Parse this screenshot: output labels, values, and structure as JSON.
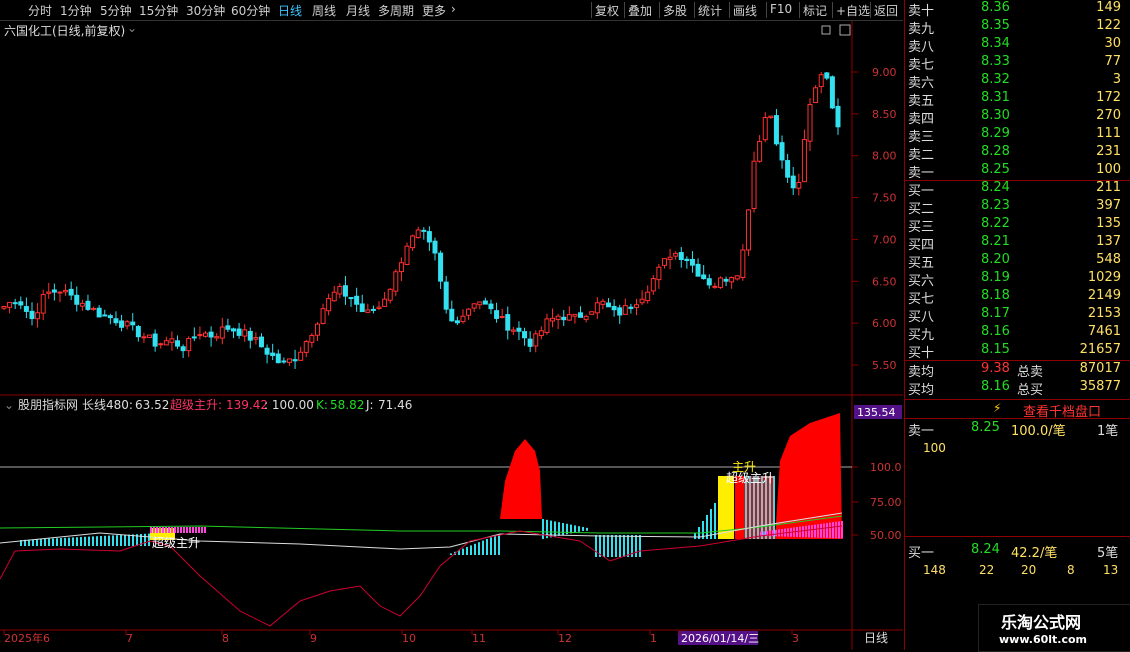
{
  "toolbar": {
    "tabs": [
      "分时",
      "1分钟",
      "5分钟",
      "15分钟",
      "30分钟",
      "60分钟",
      "日线",
      "周线",
      "月线",
      "多周期",
      "更多"
    ],
    "active_tab": "日线",
    "right_buttons": [
      "复权",
      "叠加",
      "多股",
      "统计",
      "画线",
      "F10",
      "标记",
      "+自选",
      "返回"
    ]
  },
  "chart": {
    "title": "六国化工(日线,前复权)",
    "price_axis": [
      "9.00",
      "8.50",
      "8.00",
      "7.50",
      "7.00",
      "6.50",
      "6.00",
      "5.50"
    ],
    "indicator_axis": [
      "100.0",
      "75.00",
      "50.00"
    ],
    "indicator_top_value": "135.54",
    "indicator_header": {
      "name": "股朋指标网",
      "long_label": "长线480:",
      "long_value": "63.52",
      "super_label": "超级主升:",
      "super_value": "139.42",
      "sep_value": ": 100.00",
      "k_label": "K:",
      "k_value": "58.82",
      "j_label": "J:",
      "j_value": "71.46"
    },
    "annotation_left": "超级主升",
    "annotation_right_top": "主升",
    "annotation_right": "超级主升",
    "x_axis": [
      "2025年6",
      "7",
      "8",
      "9",
      "10",
      "11",
      "12",
      "1",
      "2026/01/14/三",
      "3"
    ],
    "period_label": "日线"
  },
  "colors": {
    "up": "#ff3030",
    "down": "#33e0f0",
    "green": "#22dd22",
    "yellow": "#ffe066",
    "magenta": "#ff44dd"
  },
  "quote": {
    "sell": [
      {
        "label": "卖十",
        "price": "8.36",
        "vol": "149"
      },
      {
        "label": "卖九",
        "price": "8.35",
        "vol": "122"
      },
      {
        "label": "卖八",
        "price": "8.34",
        "vol": "30"
      },
      {
        "label": "卖七",
        "price": "8.33",
        "vol": "77"
      },
      {
        "label": "卖六",
        "price": "8.32",
        "vol": "3"
      },
      {
        "label": "卖五",
        "price": "8.31",
        "vol": "172"
      },
      {
        "label": "卖四",
        "price": "8.30",
        "vol": "270"
      },
      {
        "label": "卖三",
        "price": "8.29",
        "vol": "111"
      },
      {
        "label": "卖二",
        "price": "8.28",
        "vol": "231"
      },
      {
        "label": "卖一",
        "price": "8.25",
        "vol": "100"
      }
    ],
    "buy": [
      {
        "label": "买一",
        "price": "8.24",
        "vol": "211"
      },
      {
        "label": "买二",
        "price": "8.23",
        "vol": "397"
      },
      {
        "label": "买三",
        "price": "8.22",
        "vol": "135"
      },
      {
        "label": "买四",
        "price": "8.21",
        "vol": "137"
      },
      {
        "label": "买五",
        "price": "8.20",
        "vol": "548"
      },
      {
        "label": "买六",
        "price": "8.19",
        "vol": "1029"
      },
      {
        "label": "买七",
        "price": "8.18",
        "vol": "2149"
      },
      {
        "label": "买八",
        "price": "8.17",
        "vol": "2153"
      },
      {
        "label": "买九",
        "price": "8.16",
        "vol": "7461"
      },
      {
        "label": "买十",
        "price": "8.15",
        "vol": "21657"
      }
    ],
    "avg_sell": {
      "label": "卖均",
      "price": "9.38",
      "tlabel": "总卖",
      "vol": "87017"
    },
    "avg_buy": {
      "label": "买均",
      "price": "8.16",
      "tlabel": "总买",
      "vol": "35877"
    },
    "depth_button": "查看千档盘口",
    "depth_sell": {
      "label": "卖一",
      "price": "8.25",
      "amount": "100.0/笔",
      "count": "1笔",
      "orders": [
        "100"
      ]
    },
    "depth_buy": {
      "label": "买一",
      "price": "8.24",
      "amount": "42.2/笔",
      "count": "5笔",
      "orders": [
        "148",
        "22",
        "20",
        "8",
        "13"
      ]
    }
  },
  "watermark": {
    "title": "乐淘公式网",
    "url": "www.60lt.com"
  }
}
